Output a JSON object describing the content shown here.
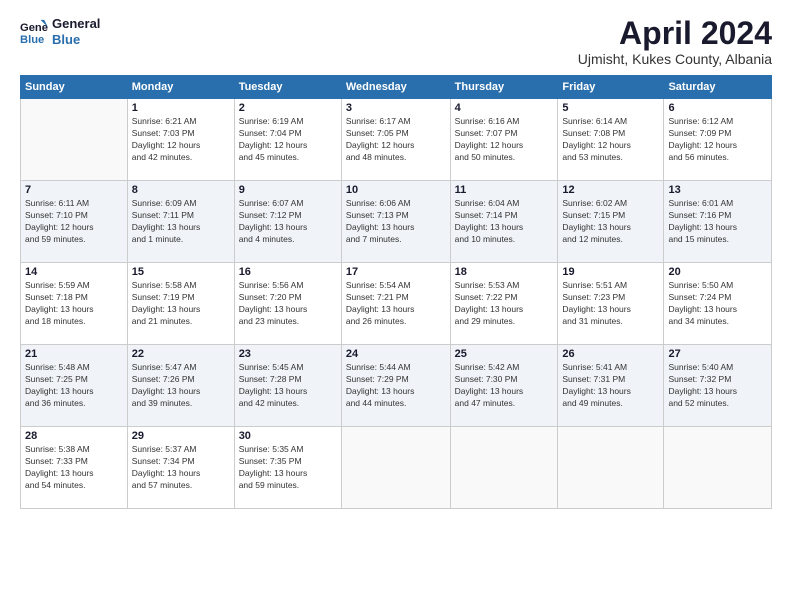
{
  "header": {
    "logo_line1": "General",
    "logo_line2": "Blue",
    "month_title": "April 2024",
    "location": "Ujmisht, Kukes County, Albania"
  },
  "days_of_week": [
    "Sunday",
    "Monday",
    "Tuesday",
    "Wednesday",
    "Thursday",
    "Friday",
    "Saturday"
  ],
  "weeks": [
    [
      {
        "day": "",
        "info": ""
      },
      {
        "day": "1",
        "info": "Sunrise: 6:21 AM\nSunset: 7:03 PM\nDaylight: 12 hours\nand 42 minutes."
      },
      {
        "day": "2",
        "info": "Sunrise: 6:19 AM\nSunset: 7:04 PM\nDaylight: 12 hours\nand 45 minutes."
      },
      {
        "day": "3",
        "info": "Sunrise: 6:17 AM\nSunset: 7:05 PM\nDaylight: 12 hours\nand 48 minutes."
      },
      {
        "day": "4",
        "info": "Sunrise: 6:16 AM\nSunset: 7:07 PM\nDaylight: 12 hours\nand 50 minutes."
      },
      {
        "day": "5",
        "info": "Sunrise: 6:14 AM\nSunset: 7:08 PM\nDaylight: 12 hours\nand 53 minutes."
      },
      {
        "day": "6",
        "info": "Sunrise: 6:12 AM\nSunset: 7:09 PM\nDaylight: 12 hours\nand 56 minutes."
      }
    ],
    [
      {
        "day": "7",
        "info": "Sunrise: 6:11 AM\nSunset: 7:10 PM\nDaylight: 12 hours\nand 59 minutes."
      },
      {
        "day": "8",
        "info": "Sunrise: 6:09 AM\nSunset: 7:11 PM\nDaylight: 13 hours\nand 1 minute."
      },
      {
        "day": "9",
        "info": "Sunrise: 6:07 AM\nSunset: 7:12 PM\nDaylight: 13 hours\nand 4 minutes."
      },
      {
        "day": "10",
        "info": "Sunrise: 6:06 AM\nSunset: 7:13 PM\nDaylight: 13 hours\nand 7 minutes."
      },
      {
        "day": "11",
        "info": "Sunrise: 6:04 AM\nSunset: 7:14 PM\nDaylight: 13 hours\nand 10 minutes."
      },
      {
        "day": "12",
        "info": "Sunrise: 6:02 AM\nSunset: 7:15 PM\nDaylight: 13 hours\nand 12 minutes."
      },
      {
        "day": "13",
        "info": "Sunrise: 6:01 AM\nSunset: 7:16 PM\nDaylight: 13 hours\nand 15 minutes."
      }
    ],
    [
      {
        "day": "14",
        "info": "Sunrise: 5:59 AM\nSunset: 7:18 PM\nDaylight: 13 hours\nand 18 minutes."
      },
      {
        "day": "15",
        "info": "Sunrise: 5:58 AM\nSunset: 7:19 PM\nDaylight: 13 hours\nand 21 minutes."
      },
      {
        "day": "16",
        "info": "Sunrise: 5:56 AM\nSunset: 7:20 PM\nDaylight: 13 hours\nand 23 minutes."
      },
      {
        "day": "17",
        "info": "Sunrise: 5:54 AM\nSunset: 7:21 PM\nDaylight: 13 hours\nand 26 minutes."
      },
      {
        "day": "18",
        "info": "Sunrise: 5:53 AM\nSunset: 7:22 PM\nDaylight: 13 hours\nand 29 minutes."
      },
      {
        "day": "19",
        "info": "Sunrise: 5:51 AM\nSunset: 7:23 PM\nDaylight: 13 hours\nand 31 minutes."
      },
      {
        "day": "20",
        "info": "Sunrise: 5:50 AM\nSunset: 7:24 PM\nDaylight: 13 hours\nand 34 minutes."
      }
    ],
    [
      {
        "day": "21",
        "info": "Sunrise: 5:48 AM\nSunset: 7:25 PM\nDaylight: 13 hours\nand 36 minutes."
      },
      {
        "day": "22",
        "info": "Sunrise: 5:47 AM\nSunset: 7:26 PM\nDaylight: 13 hours\nand 39 minutes."
      },
      {
        "day": "23",
        "info": "Sunrise: 5:45 AM\nSunset: 7:28 PM\nDaylight: 13 hours\nand 42 minutes."
      },
      {
        "day": "24",
        "info": "Sunrise: 5:44 AM\nSunset: 7:29 PM\nDaylight: 13 hours\nand 44 minutes."
      },
      {
        "day": "25",
        "info": "Sunrise: 5:42 AM\nSunset: 7:30 PM\nDaylight: 13 hours\nand 47 minutes."
      },
      {
        "day": "26",
        "info": "Sunrise: 5:41 AM\nSunset: 7:31 PM\nDaylight: 13 hours\nand 49 minutes."
      },
      {
        "day": "27",
        "info": "Sunrise: 5:40 AM\nSunset: 7:32 PM\nDaylight: 13 hours\nand 52 minutes."
      }
    ],
    [
      {
        "day": "28",
        "info": "Sunrise: 5:38 AM\nSunset: 7:33 PM\nDaylight: 13 hours\nand 54 minutes."
      },
      {
        "day": "29",
        "info": "Sunrise: 5:37 AM\nSunset: 7:34 PM\nDaylight: 13 hours\nand 57 minutes."
      },
      {
        "day": "30",
        "info": "Sunrise: 5:35 AM\nSunset: 7:35 PM\nDaylight: 13 hours\nand 59 minutes."
      },
      {
        "day": "",
        "info": ""
      },
      {
        "day": "",
        "info": ""
      },
      {
        "day": "",
        "info": ""
      },
      {
        "day": "",
        "info": ""
      }
    ]
  ]
}
